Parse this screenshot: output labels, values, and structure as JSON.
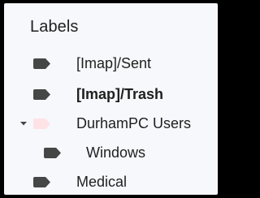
{
  "sidebar": {
    "section_title": "Labels",
    "label_color": "#1f1f1f",
    "icon_color_default": "#444746",
    "items": [
      {
        "label": "[Imap]/Sent",
        "bold": false,
        "icon": "label-tag-icon",
        "color": "#444746"
      },
      {
        "label": "[Imap]/Trash",
        "bold": true,
        "icon": "label-tag-icon",
        "color": "#444746"
      },
      {
        "label": "DurhamPC Users",
        "bold": false,
        "icon": "label-tag-icon",
        "color": "#fde2e6",
        "expanded": true,
        "caret_icon": "caret-down-icon"
      },
      {
        "label": "Windows",
        "bold": false,
        "icon": "label-tag-icon",
        "color": "#444746",
        "nested": true
      },
      {
        "label": "Medical",
        "bold": false,
        "icon": "label-tag-icon",
        "color": "#444746"
      }
    ]
  }
}
